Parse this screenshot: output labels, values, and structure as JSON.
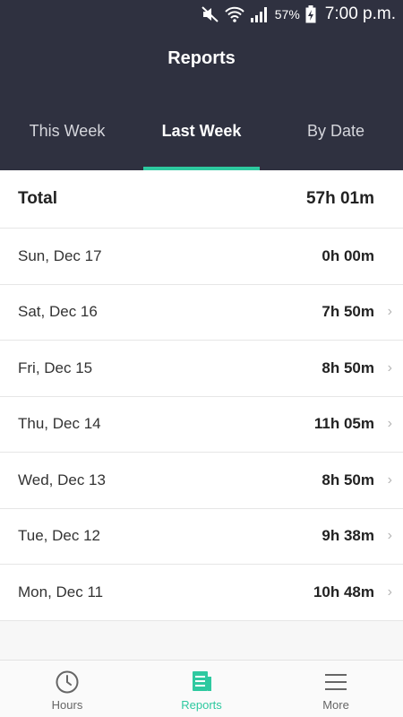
{
  "status": {
    "battery": "57%",
    "time": "7:00 p.m."
  },
  "header": {
    "title": "Reports"
  },
  "tabs": [
    {
      "label": "This Week",
      "active": false
    },
    {
      "label": "Last Week",
      "active": true
    },
    {
      "label": "By Date",
      "active": false
    }
  ],
  "total": {
    "label": "Total",
    "value": "57h 01m"
  },
  "days": [
    {
      "label": "Sun, Dec 17",
      "value": "0h 00m"
    },
    {
      "label": "Sat, Dec 16",
      "value": "7h 50m"
    },
    {
      "label": "Fri, Dec 15",
      "value": "8h 50m"
    },
    {
      "label": "Thu, Dec 14",
      "value": "11h 05m"
    },
    {
      "label": "Wed, Dec 13",
      "value": "8h 50m"
    },
    {
      "label": "Tue, Dec 12",
      "value": "9h 38m"
    },
    {
      "label": "Mon, Dec 11",
      "value": "10h 48m"
    }
  ],
  "nav": [
    {
      "label": "Hours",
      "icon": "clock-icon"
    },
    {
      "label": "Reports",
      "icon": "reports-icon",
      "active": true
    },
    {
      "label": "More",
      "icon": "menu-icon"
    }
  ],
  "colors": {
    "accent": "#2ec9a0",
    "header_bg": "#2f3140"
  }
}
